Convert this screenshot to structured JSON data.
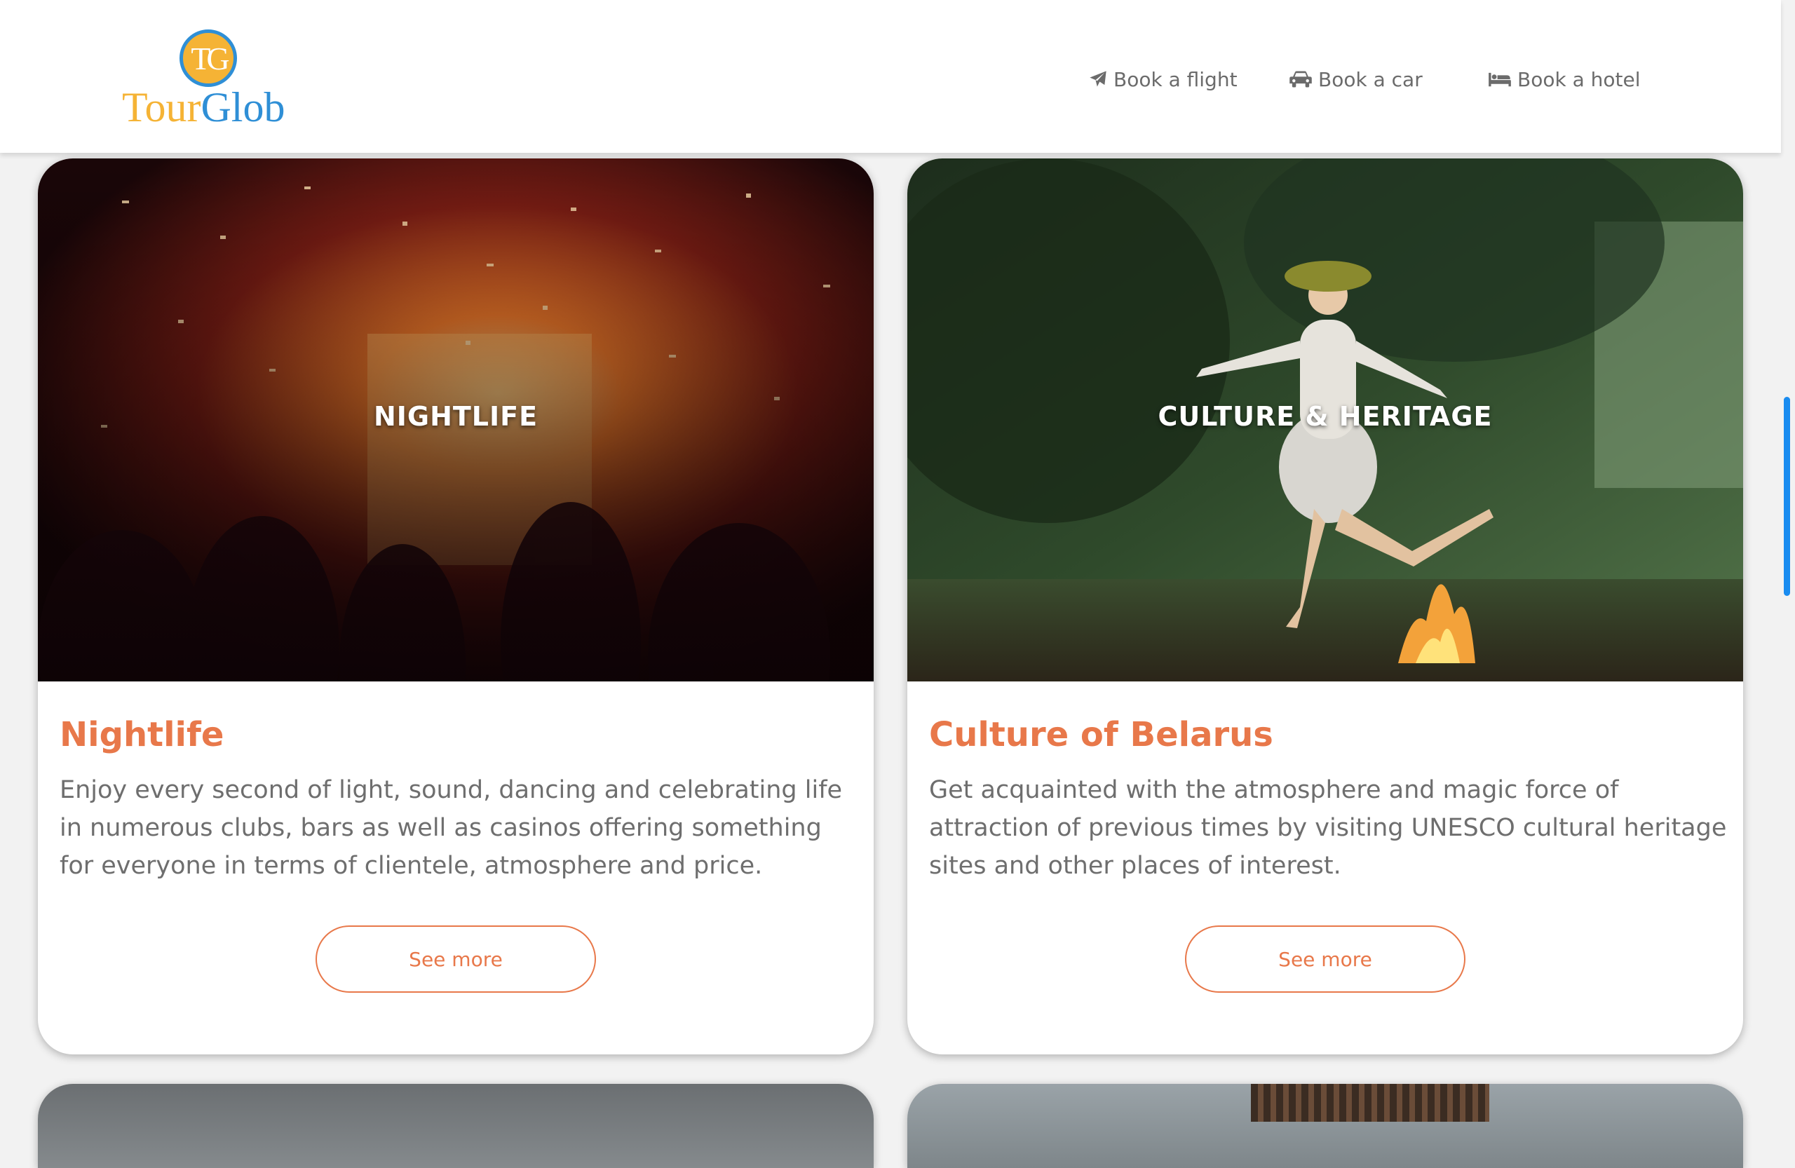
{
  "brand": {
    "logo_initials": "TG",
    "logo_name_part1": "Tour",
    "logo_name_part2": "Glob"
  },
  "nav": {
    "items": [
      {
        "label": "Book a flight",
        "icon": "paper-plane-icon"
      },
      {
        "label": "Book a car",
        "icon": "car-icon"
      },
      {
        "label": "Book a hotel",
        "icon": "bed-icon"
      }
    ]
  },
  "cards": [
    {
      "overlay": "NIGHTLIFE",
      "title": "Nightlife",
      "description": "Enjoy every second of light, sound, dancing and celebrating life in numerous clubs, bars as well as casinos offering something for everyone in terms of clientele, atmosphere and price.",
      "button": "See more"
    },
    {
      "overlay": "CULTURE & HERITAGE",
      "title": "Culture of Belarus",
      "description": "Get acquainted with the atmosphere and magic force of attraction of previous times by visiting UNESCO cultural heritage sites and other places of interest.",
      "button": "See more"
    }
  ],
  "colors": {
    "accent": "#e8784a",
    "logo_orange": "#f5b335",
    "logo_blue": "#2f8fd6",
    "scrollbar": "#1a8cf0"
  }
}
